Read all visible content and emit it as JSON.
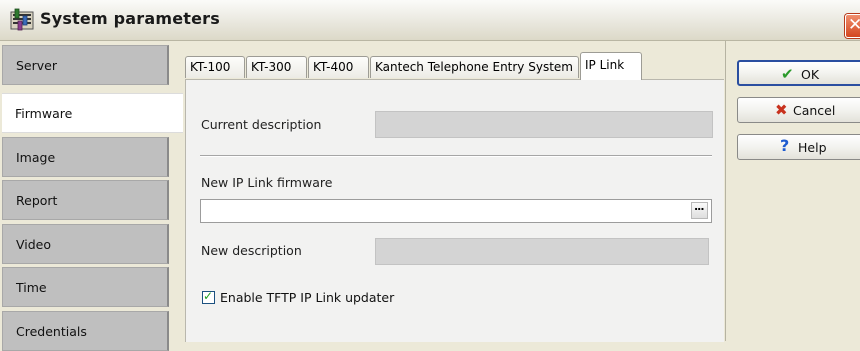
{
  "window": {
    "title": "System parameters",
    "close_glyph": "✕"
  },
  "nav": {
    "items": [
      {
        "label": "Server",
        "active": false
      },
      {
        "label": "Firmware",
        "active": true
      },
      {
        "label": "Image",
        "active": false
      },
      {
        "label": "Report",
        "active": false
      },
      {
        "label": "Video",
        "active": false
      },
      {
        "label": "Time",
        "active": false
      },
      {
        "label": "Credentials",
        "active": false
      }
    ]
  },
  "tabs": [
    {
      "label": "KT-100"
    },
    {
      "label": "KT-300"
    },
    {
      "label": "KT-400"
    },
    {
      "label": "Kantech Telephone Entry System"
    },
    {
      "label": "IP Link",
      "active": true
    }
  ],
  "form": {
    "current_description_label": "Current description",
    "current_description_value": "",
    "new_firmware_label": "New IP Link firmware",
    "new_firmware_value": "",
    "browse_label": "...",
    "new_description_label": "New description",
    "new_description_value": "",
    "enable_tftp_label": "Enable TFTP IP Link updater",
    "enable_tftp_checked": true
  },
  "buttons": {
    "ok": {
      "label": "OK",
      "icon": "checkmark-icon"
    },
    "cancel": {
      "label": "Cancel",
      "icon": "red-x-icon"
    },
    "help": {
      "label": "Help",
      "icon": "question-mark-icon"
    }
  },
  "colors": {
    "title_close_red": "#d3461f",
    "nav_tab_gray": "#bfbfbf",
    "field_disabled": "#d4d4d4",
    "ok_check_green": "#2a9a2a",
    "cancel_x_red": "#c8321e",
    "help_blue": "#1e5bd0"
  }
}
